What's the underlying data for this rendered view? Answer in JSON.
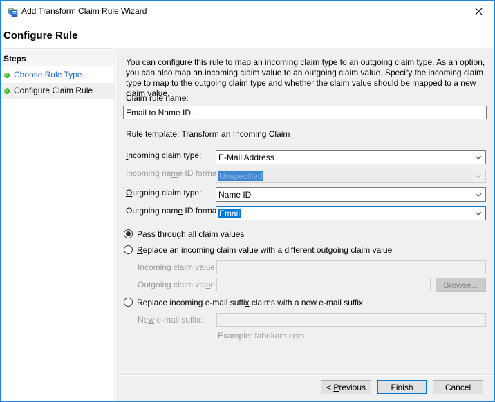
{
  "window": {
    "title": "Add Transform Claim Rule Wizard",
    "icon": "adfs-wizard-icon",
    "close_icon": "close-icon",
    "accent_color": "#1883d7"
  },
  "page_title": "Configure Rule",
  "steps": {
    "header": "Steps",
    "items": [
      {
        "label": "Choose Rule Type",
        "state": "link",
        "icon": "green-dot-icon"
      },
      {
        "label": "Configure Claim Rule",
        "state": "current",
        "icon": "green-dot-icon"
      }
    ]
  },
  "main": {
    "description": "You can configure this rule to map an incoming claim type to an outgoing claim type. As an option, you can also map an incoming claim value to an outgoing claim value. Specify the incoming claim type to map to the outgoing claim type and whether the claim value should be mapped to a new claim value.",
    "claim_rule_name": {
      "label_access": "C",
      "label_rest": "laim rule name:",
      "value": "Email to Name ID."
    },
    "rule_template": "Rule template: Transform an Incoming Claim",
    "incoming_claim_type": {
      "label_access": "I",
      "label_rest": "ncoming claim type:",
      "value": "E-Mail Address"
    },
    "incoming_name_id_format": {
      "label_pre": "Incoming na",
      "label_access": "m",
      "label_post": "e ID format:",
      "value": "Unspecified",
      "disabled": true
    },
    "outgoing_claim_type": {
      "label_access": "O",
      "label_rest": "utgoing claim type:",
      "value": "Name ID"
    },
    "outgoing_name_id_format": {
      "label_pre": "Outgoing nam",
      "label_access": "e",
      "label_post": " ID format:",
      "value": "Email",
      "focused": true
    },
    "options": {
      "pass_through": {
        "pre": "Pa",
        "access": "s",
        "post": "s through all claim values",
        "checked": true
      },
      "replace_value": {
        "pre": "",
        "access": "R",
        "post": "eplace an incoming claim value with a different outgoing claim value",
        "checked": false
      },
      "incoming_claim_value": {
        "pre": "Incoming claim ",
        "access": "v",
        "post": "alue:",
        "value": ""
      },
      "outgoing_claim_value": {
        "pre": "Outgoing claim val",
        "access": "u",
        "post": "e:",
        "value": ""
      },
      "browse_button": {
        "pre": "",
        "access": "B",
        "post": "rowse..."
      },
      "replace_suffix": {
        "pre": "Replace incoming e-mail suffi",
        "access": "x",
        "post": " claims with a new e-mail suffix",
        "checked": false
      },
      "new_suffix": {
        "pre": "Ne",
        "access": "w",
        "post": " e-mail suffix:",
        "value": ""
      },
      "suffix_example": "Example: fabrikam.com"
    }
  },
  "footer": {
    "previous": {
      "pre": "< ",
      "access": "P",
      "post": "revious"
    },
    "finish": "Finish",
    "cancel": "Cancel"
  }
}
